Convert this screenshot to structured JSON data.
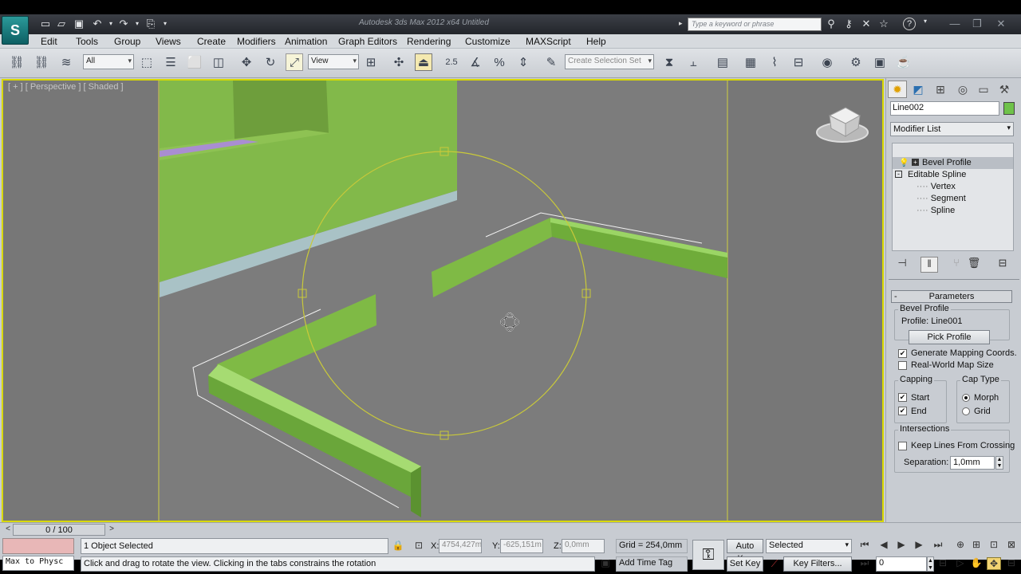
{
  "app": {
    "title": "Autodesk 3ds Max 2012 x64    Untitled",
    "logo": "3ds-max-logo",
    "search_placeholder": "Type a keyword or phrase",
    "help_label": "?"
  },
  "menu": [
    "Edit",
    "Tools",
    "Group",
    "Views",
    "Create",
    "Modifiers",
    "Animation",
    "Graph Editors",
    "Rendering",
    "Customize",
    "MAXScript",
    "Help"
  ],
  "toolbar": {
    "selection_filter": "All",
    "reference_coord": "View",
    "named_selection": "Create Selection Set",
    "snap_label": "2.5",
    "angle_snap": "%"
  },
  "viewport": {
    "label": "[ + ] [ Perspective ] [ Shaded ]",
    "border_color": "#d9d900"
  },
  "command_panel": {
    "object_name": "Line002",
    "object_color": "#6fc24a",
    "modifier_list": "Modifier List",
    "stack": [
      {
        "label": "Bevel Profile",
        "selected": true
      },
      {
        "label": "Editable Spline",
        "selected": false
      },
      {
        "label": "Vertex",
        "selected": false
      },
      {
        "label": "Segment",
        "selected": false
      },
      {
        "label": "Spline",
        "selected": false
      }
    ],
    "rollout_title": "Parameters",
    "rollout_collapse": "-",
    "bevel_profile_group": "Bevel Profile",
    "profile_label": "Profile: Line001",
    "pick_profile": "Pick Profile",
    "gen_mapping": "Generate Mapping Coords.",
    "real_world": "Real-World Map Size",
    "capping_group": "Capping",
    "cap_start": "Start",
    "cap_end": "End",
    "cap_type_group": "Cap Type",
    "cap_morph": "Morph",
    "cap_grid": "Grid",
    "intersections_group": "Intersections",
    "keep_lines": "Keep Lines From Crossing",
    "separation_label": "Separation:",
    "separation_value": "1,0mm"
  },
  "status": {
    "time_slider": "0 / 100",
    "maxscript_listener": "Max to Physc",
    "selection_info": "1 Object Selected",
    "prompt": "Click and drag to rotate the view.  Clicking in the tabs constrains the rotation",
    "x_label": "X:",
    "x_value": "4754,427m",
    "y_label": "Y:",
    "y_value": "-625,151m",
    "z_label": "Z:",
    "z_value": "0,0mm",
    "grid": "Grid = 254,0mm",
    "add_time_tag": "Add Time Tag",
    "auto_key": "Auto Key",
    "set_key": "Set Key",
    "key_mode": "Selected",
    "key_filters": "Key Filters...",
    "frame": "0"
  }
}
